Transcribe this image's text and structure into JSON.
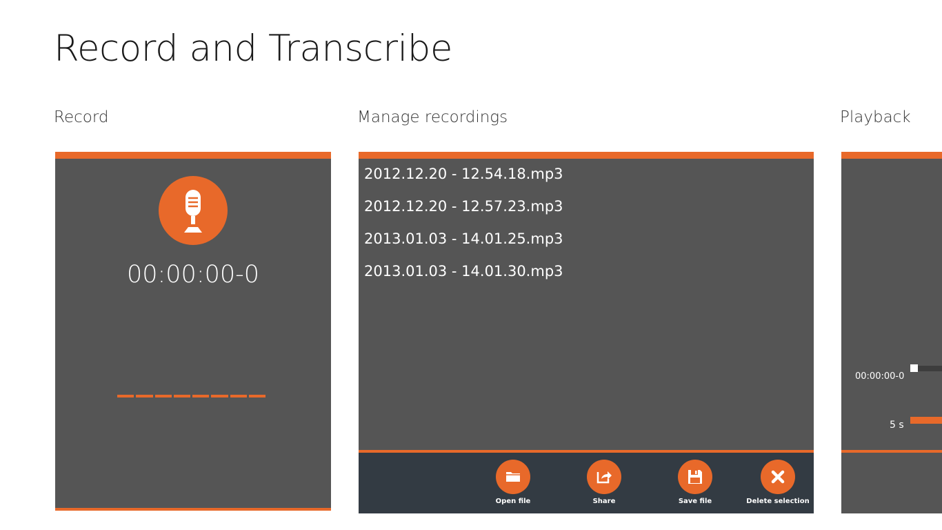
{
  "app": {
    "title": "Record and Transcribe"
  },
  "colors": {
    "accent": "#e8692a",
    "panel": "#555555",
    "toolbar": "#333b43"
  },
  "record": {
    "title": "Record",
    "mic_icon": "microphone-icon",
    "timer": "00:00:00-0"
  },
  "manage": {
    "title": "Manage recordings",
    "files": [
      "2012.12.20 - 12.54.18.mp3",
      "2012.12.20 - 12.57.23.mp3",
      "2013.01.03 - 14.01.25.mp3",
      "2013.01.03 - 14.01.30.mp3"
    ],
    "toolbar": [
      {
        "label": "Open file",
        "icon": "folder-icon"
      },
      {
        "label": "Share",
        "icon": "share-icon"
      },
      {
        "label": "Save file",
        "icon": "floppy-disk-icon"
      },
      {
        "label": "Delete selection",
        "icon": "close-icon"
      }
    ]
  },
  "playback": {
    "title": "Playback",
    "position": "00:00:00-0",
    "skip_label": "5 s"
  }
}
